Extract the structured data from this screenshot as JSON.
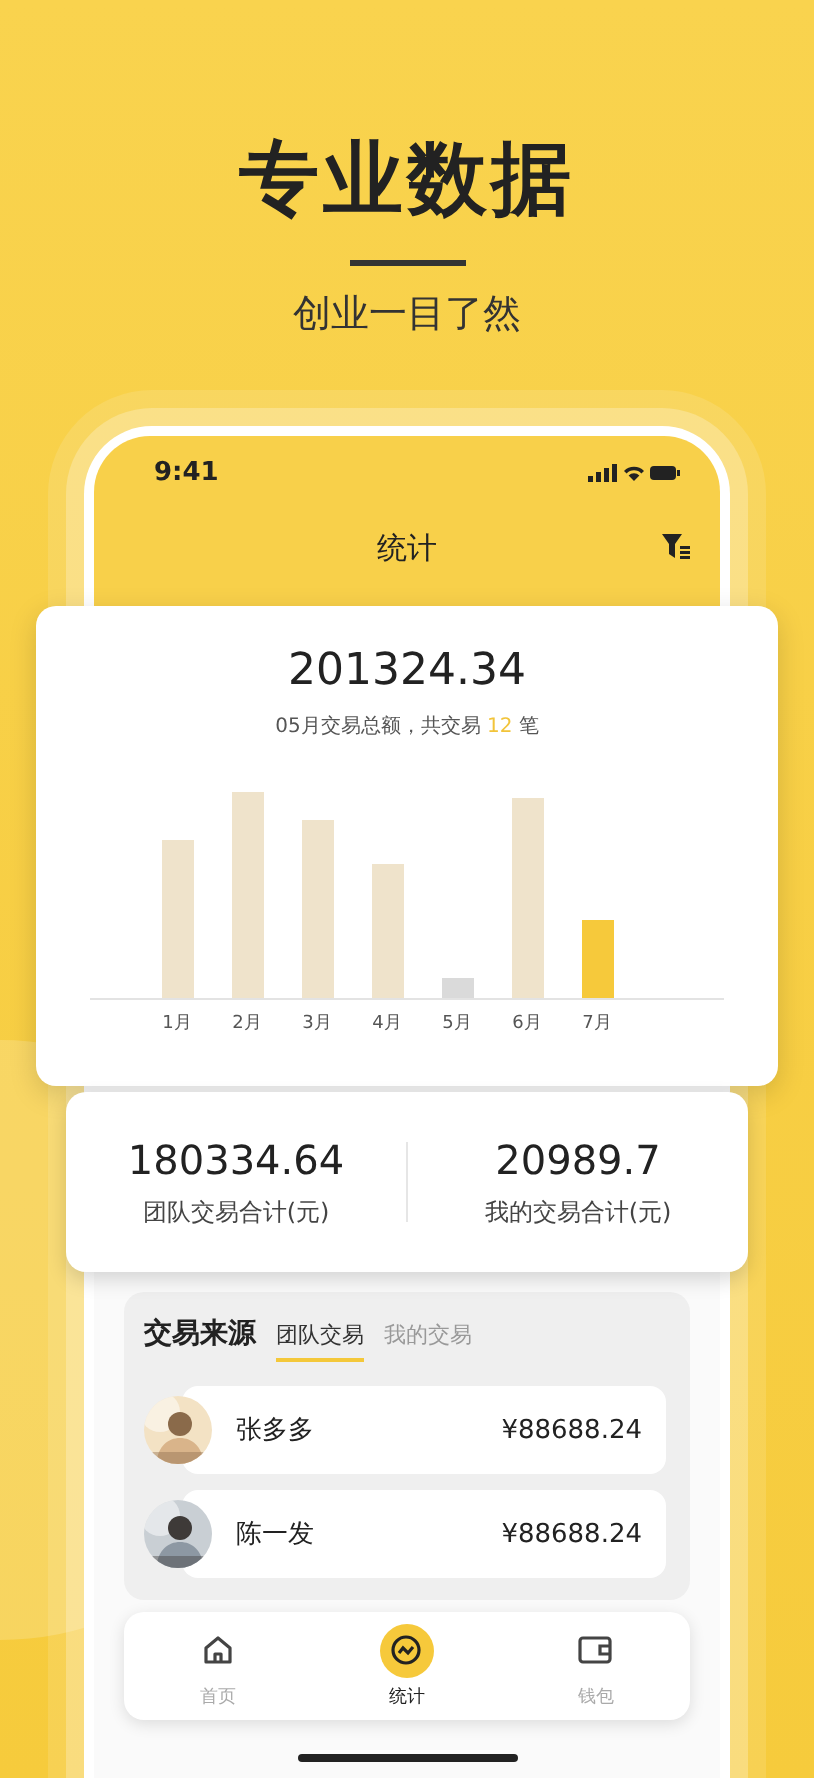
{
  "headline": {
    "title": "专业数据",
    "subtitle": "创业一目了然"
  },
  "status_bar": {
    "time": "9:41"
  },
  "nav": {
    "title": "统计"
  },
  "summary": {
    "total": "201324.34",
    "caption_before": "05月交易总额，共交易",
    "count": "12",
    "caption_after": "笔"
  },
  "months": [
    {
      "label": "1月",
      "current": false,
      "selected": false
    },
    {
      "label": "2月",
      "current": false,
      "selected": false
    },
    {
      "label": "3月",
      "current": false,
      "selected": false
    },
    {
      "label": "4月",
      "current": false,
      "selected": false
    },
    {
      "label": "5月",
      "current": true,
      "selected": false
    },
    {
      "label": "6月",
      "current": false,
      "selected": false
    },
    {
      "label": "7月",
      "current": false,
      "selected": true
    }
  ],
  "totals": [
    {
      "value": "180334.64",
      "label": "团队交易合计(元)"
    },
    {
      "value": "20989.7",
      "label": "我的交易合计(元)"
    }
  ],
  "sources": {
    "title": "交易来源",
    "tabs": [
      {
        "label": "团队交易",
        "selected": true
      },
      {
        "label": "我的交易",
        "selected": false
      }
    ],
    "rows": [
      {
        "name": "张多多",
        "amount": "¥88688.24"
      },
      {
        "name": "陈一发",
        "amount": "¥88688.24"
      }
    ]
  },
  "tab_bar": [
    {
      "label": "首页",
      "selected": false
    },
    {
      "label": "统计",
      "selected": true
    },
    {
      "label": "钱包",
      "selected": false
    }
  ]
}
